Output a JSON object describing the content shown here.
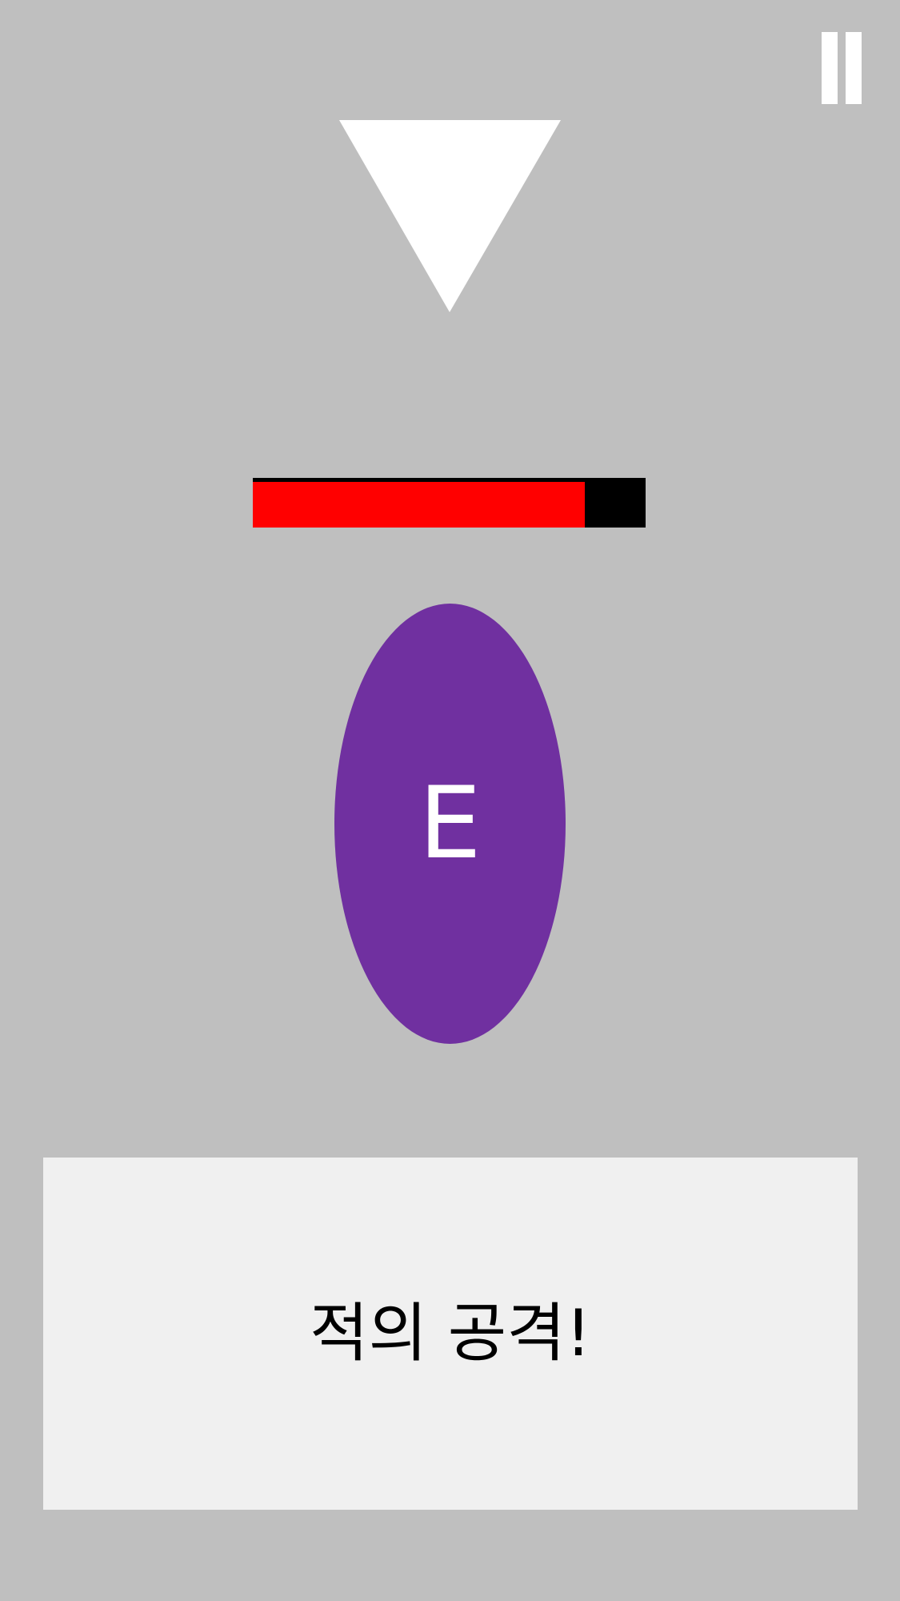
{
  "hud": {
    "pause_icon": "pause-icon"
  },
  "indicator": {
    "icon": "down-triangle-icon",
    "color": "#ffffff"
  },
  "enemy": {
    "hp_fraction": 0.845,
    "hp_color": "#ff0000",
    "hp_background": "#000000",
    "label": "E",
    "color": "#7030a0"
  },
  "dialog": {
    "message": "적의 공격!"
  }
}
